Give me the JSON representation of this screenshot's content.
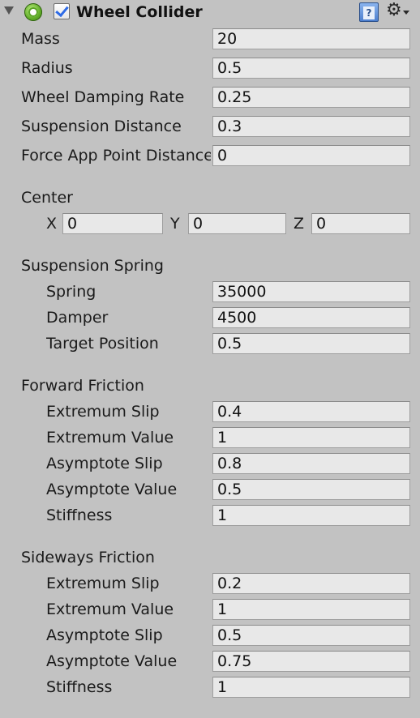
{
  "component": {
    "title": "Wheel Collider",
    "enabled": true,
    "help_icon": "help-book-icon",
    "settings_icon": "gear-icon"
  },
  "fields": {
    "mass": {
      "label": "Mass",
      "value": "20"
    },
    "radius": {
      "label": "Radius",
      "value": "0.5"
    },
    "wheel_damping_rate": {
      "label": "Wheel Damping Rate",
      "value": "0.25"
    },
    "suspension_distance": {
      "label": "Suspension Distance",
      "value": "0.3"
    },
    "force_app_point_distance": {
      "label": "Force App Point Distance",
      "value": "0"
    }
  },
  "center": {
    "label": "Center",
    "x": {
      "label": "X",
      "value": "0"
    },
    "y": {
      "label": "Y",
      "value": "0"
    },
    "z": {
      "label": "Z",
      "value": "0"
    }
  },
  "suspension_spring": {
    "label": "Suspension Spring",
    "spring": {
      "label": "Spring",
      "value": "35000"
    },
    "damper": {
      "label": "Damper",
      "value": "4500"
    },
    "target_position": {
      "label": "Target Position",
      "value": "0.5"
    }
  },
  "forward_friction": {
    "label": "Forward Friction",
    "extremum_slip": {
      "label": "Extremum Slip",
      "value": "0.4"
    },
    "extremum_value": {
      "label": "Extremum Value",
      "value": "1"
    },
    "asymptote_slip": {
      "label": "Asymptote Slip",
      "value": "0.8"
    },
    "asymptote_value": {
      "label": "Asymptote Value",
      "value": "0.5"
    },
    "stiffness": {
      "label": "Stiffness",
      "value": "1"
    }
  },
  "sideways_friction": {
    "label": "Sideways Friction",
    "extremum_slip": {
      "label": "Extremum Slip",
      "value": "0.2"
    },
    "extremum_value": {
      "label": "Extremum Value",
      "value": "1"
    },
    "asymptote_slip": {
      "label": "Asymptote Slip",
      "value": "0.5"
    },
    "asymptote_value": {
      "label": "Asymptote Value",
      "value": "0.75"
    },
    "stiffness": {
      "label": "Stiffness",
      "value": "1"
    }
  }
}
